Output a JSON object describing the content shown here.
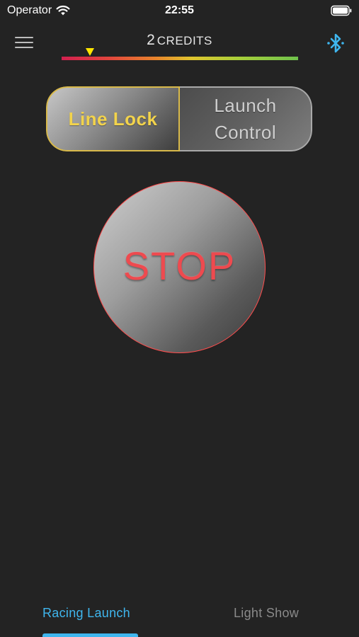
{
  "status_bar": {
    "carrier": "Operator",
    "time": "22:55"
  },
  "header": {
    "credits_count": "2",
    "credits_label": "CREDITS",
    "gauge_marker_fraction": 0.12
  },
  "mode_control": {
    "segments": [
      {
        "label": "Line Lock",
        "selected": true
      },
      {
        "label": "Launch Control",
        "selected": false
      }
    ]
  },
  "stop_button": {
    "label": "STOP"
  },
  "tabs": [
    {
      "label": "Racing Launch",
      "selected": true
    },
    {
      "label": "Light Show",
      "selected": false
    }
  ],
  "colors": {
    "background": "#232323",
    "accent_blue": "#3fb6ee",
    "selected_gold": "#f2d34c",
    "stop_red": "#ee4a4f",
    "gauge_marker": "#ffe600"
  },
  "icons": {
    "menu": "hamburger-menu-icon",
    "bluetooth": "bluetooth-icon",
    "wifi": "wifi-icon",
    "battery": "battery-icon"
  }
}
